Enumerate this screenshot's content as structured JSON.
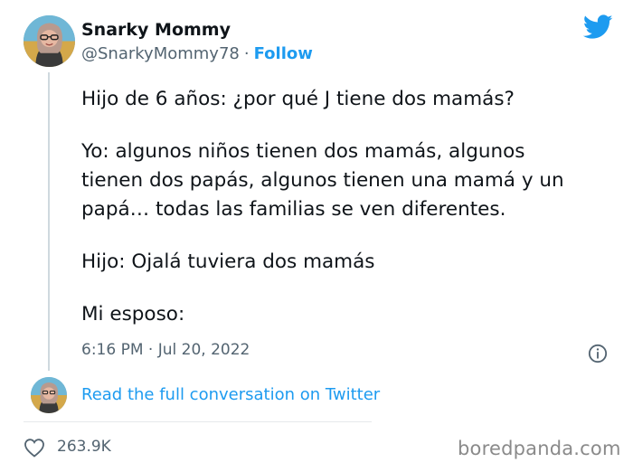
{
  "author": {
    "display_name": "Snarky Mommy",
    "handle": "@SnarkyMommy78",
    "separator": "·",
    "follow_label": "Follow"
  },
  "tweet": {
    "paragraphs": [
      "Hijo de 6 años: ¿por qué J tiene dos mamás?",
      "Yo: algunos niños tienen dos mamás, algunos\ntienen dos papás, algunos tienen una mamá y un\npapá… todas las familias se ven diferentes.",
      "Hijo: Ojalá tuviera dos mamás",
      "Mi esposo:"
    ],
    "timestamp": "6:16 PM · Jul 20, 2022"
  },
  "thread": {
    "read_more_label": "Read the full conversation on Twitter"
  },
  "engagement": {
    "likes": "263.9K"
  },
  "watermark": "boredpanda.com",
  "icons": {
    "brand": "twitter-bird-icon",
    "info": "info-icon",
    "like": "heart-icon"
  },
  "colors": {
    "twitter_blue": "#1d9bf0",
    "text_primary": "#0f1419",
    "text_secondary": "#536471"
  }
}
